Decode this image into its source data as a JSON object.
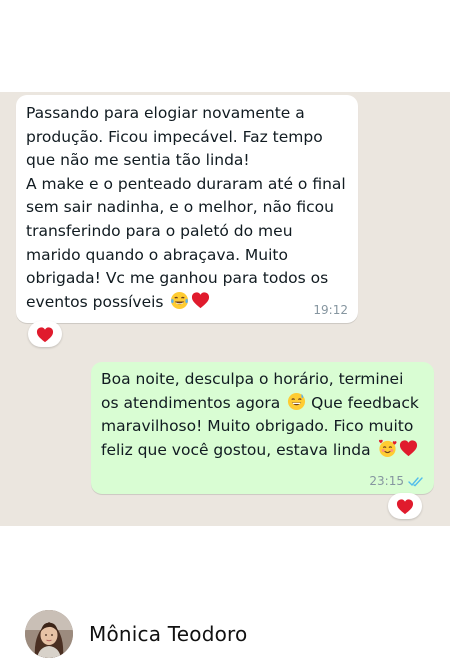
{
  "chat": {
    "incoming": {
      "text": "Passando para elogiar novamente a produção. Ficou impecável. Faz tempo que não me sentia tão linda!\nA make e o penteado duraram até o final sem sair nadinha, e o melhor, não ficou transferindo para o paletó do meu marido quando o abraçava. Muito obrigada! Vc me ganhou para todos os eventos possíveis",
      "emojis": [
        "tears-of-joy-emoji",
        "red-heart-emoji"
      ],
      "time": "19:12",
      "reaction": "red-heart-emoji"
    },
    "outgoing": {
      "text_part1": "Boa noite, desculpa o horário, terminei os atendimentos agora",
      "text_part2": "Que feedback maravilhoso! Muito obrigado. Fico muito feliz que você gostou, estava linda",
      "emojis": [
        "grinning-sweat-emoji",
        "smiling-hearts-emoji",
        "red-heart-emoji"
      ],
      "time": "23:15",
      "status": "read",
      "reaction": "red-heart-emoji"
    }
  },
  "footer": {
    "author_name": "Mônica Teodoro",
    "avatar": "profile-photo"
  },
  "colors": {
    "chat_background": "#ebe6df",
    "incoming_bubble": "#ffffff",
    "outgoing_bubble": "#d9fdd3",
    "read_ticks": "#53bdeb",
    "heart": "#e01b2d"
  }
}
